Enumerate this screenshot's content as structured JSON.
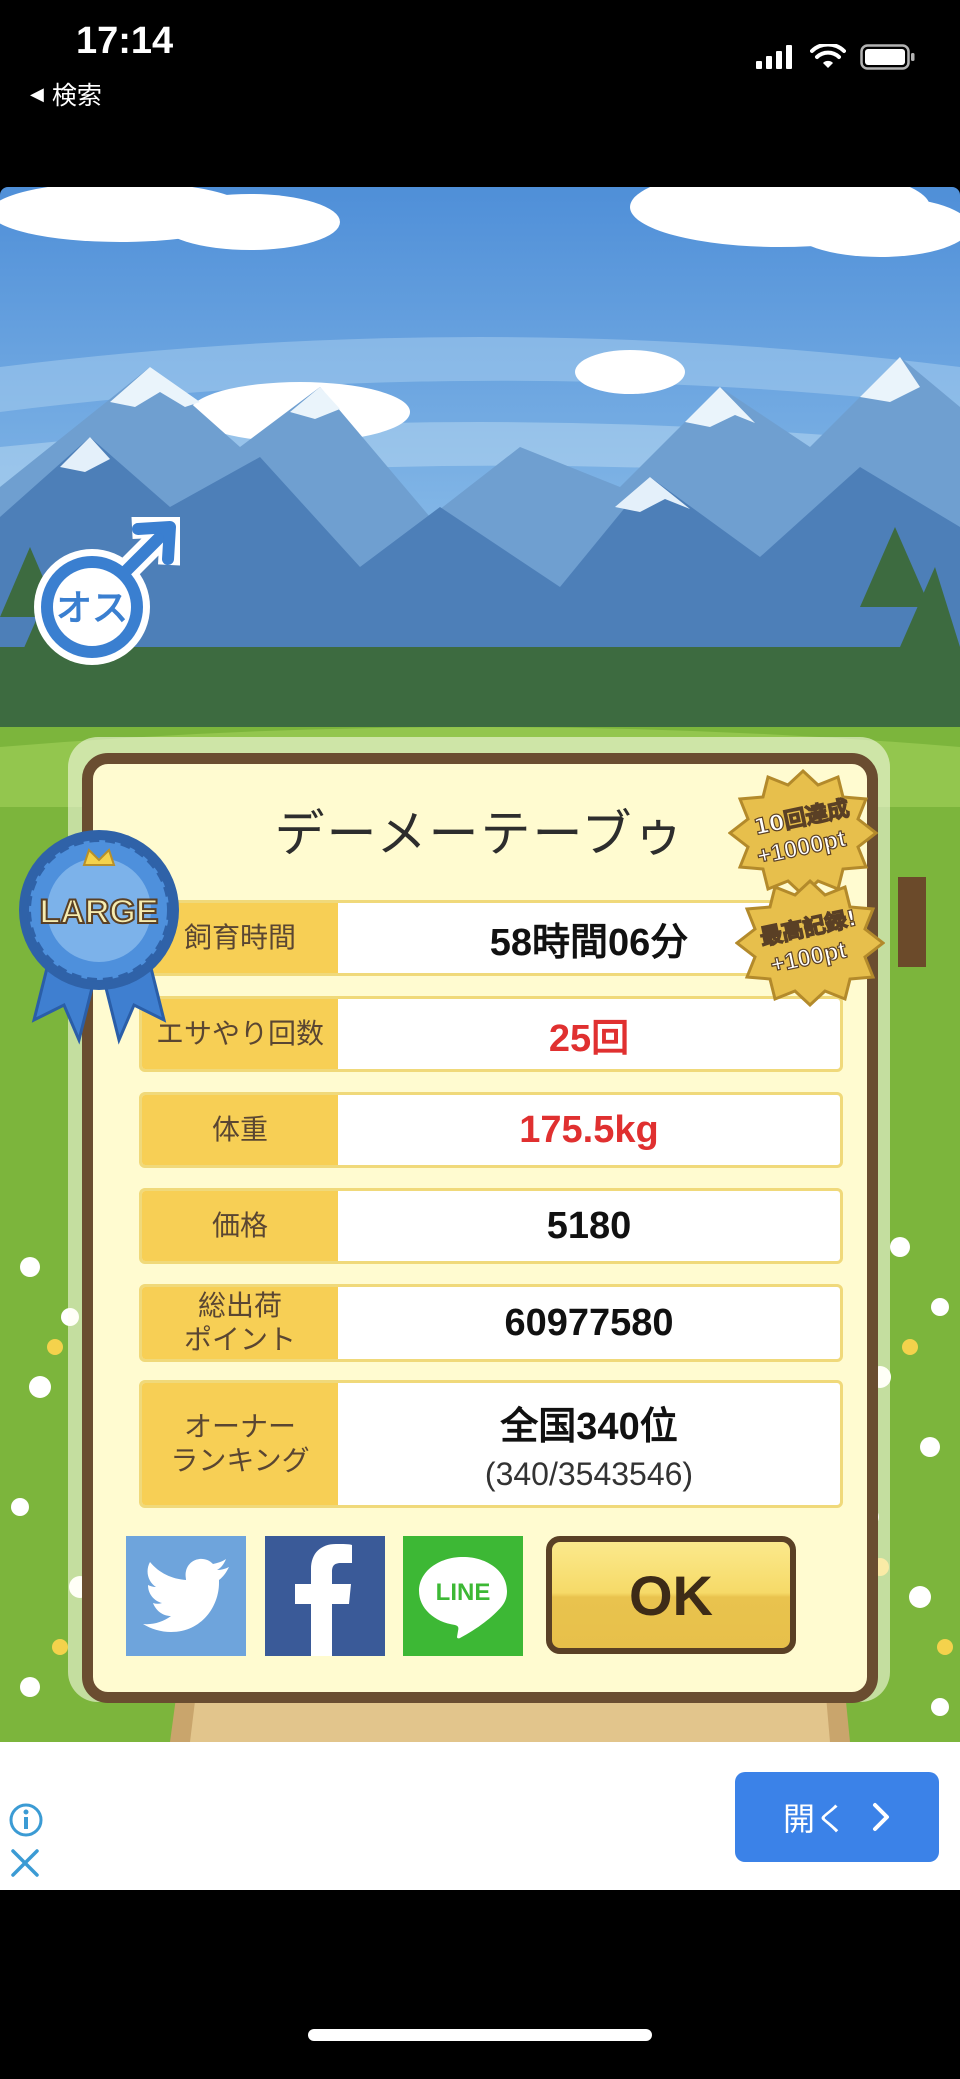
{
  "status_bar": {
    "time": "17:14",
    "back_label": "検索"
  },
  "dialog": {
    "title": "デーメーテーブゥ",
    "rows": [
      {
        "label": "飼育時間",
        "value": "58時間06分",
        "highlight": false
      },
      {
        "label": "エサやり回数",
        "value": "25回",
        "highlight": true
      },
      {
        "label": "体重",
        "value": "175.5kg",
        "highlight": true
      },
      {
        "label": "価格",
        "value": "5180",
        "highlight": false
      },
      {
        "label": "総出荷\nポイント",
        "value": "60977580",
        "highlight": false
      },
      {
        "label": "オーナー\nランキング",
        "value": "全国340位",
        "sub_value": "(340/3543546)",
        "highlight": false
      }
    ],
    "ok_label": "OK",
    "share": {
      "twitter": "twitter",
      "facebook": "f",
      "line": "LINE"
    }
  },
  "badges": {
    "gender": "オス",
    "size": "LARGE",
    "bonus1_line1": "10回達成",
    "bonus1_line2": "+1000pt",
    "bonus2_line1": "最高記録!",
    "bonus2_line2": "+100pt"
  },
  "ad": {
    "open_label": "開く"
  },
  "colors": {
    "label_bg": "#f7cf55",
    "highlight_value": "#e03030",
    "dialog_border": "#6a4d30",
    "open_button": "#3b82e8"
  }
}
